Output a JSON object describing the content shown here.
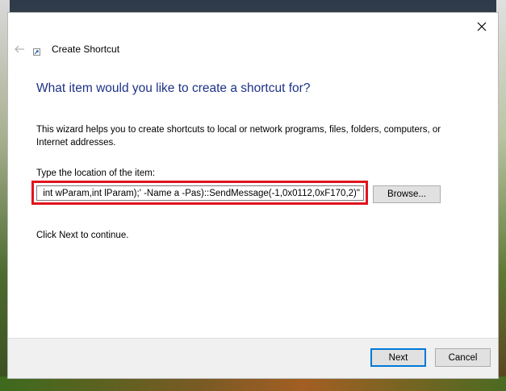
{
  "window": {
    "title": "Create Shortcut",
    "close_icon": "close-icon",
    "back_icon": "back-arrow-icon",
    "title_icon": "shortcut-icon"
  },
  "main": {
    "heading": "What item would you like to create a shortcut for?",
    "description": "This wizard helps you to create shortcuts to local or network programs, files, folders, computers, or Internet addresses.",
    "location_label": "Type the location of the item:",
    "location_value": " int wParam,int lParam);' -Name a -Pas)::SendMessage(-1,0x0112,0xF170,2)\"",
    "browse_label": "Browse...",
    "continue_text": "Click Next to continue."
  },
  "footer": {
    "next_label": "Next",
    "cancel_label": "Cancel"
  },
  "colors": {
    "heading": "#1e3287",
    "highlight_border": "#e0141e",
    "accent": "#0078d7"
  }
}
